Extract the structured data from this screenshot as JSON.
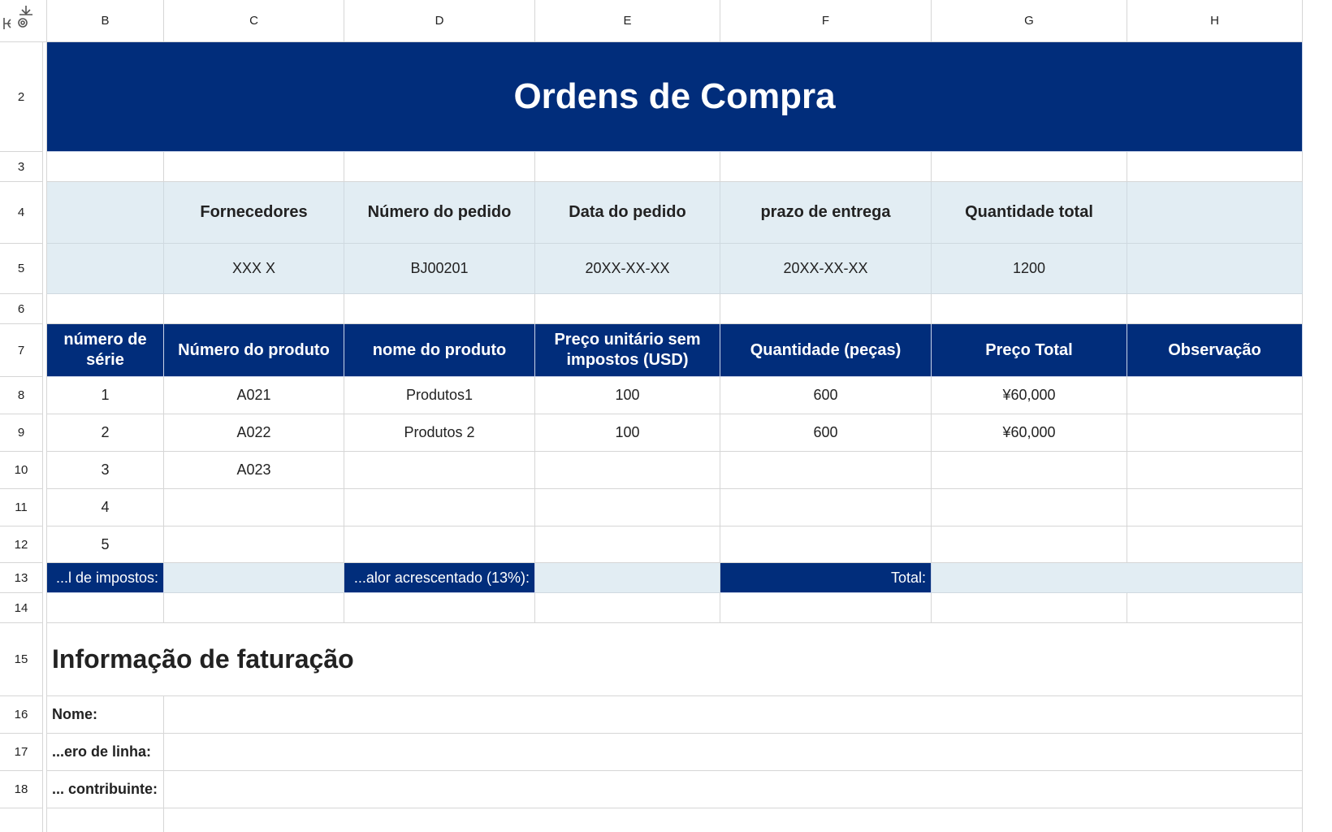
{
  "columns": [
    "B",
    "C",
    "D",
    "E",
    "F",
    "G",
    "H"
  ],
  "rows": [
    "2",
    "3",
    "4",
    "5",
    "6",
    "7",
    "8",
    "9",
    "10",
    "11",
    "12",
    "13",
    "14",
    "15",
    "16",
    "17",
    "18"
  ],
  "title": "Ordens de Compra",
  "summary": {
    "headers": [
      "Fornecedores",
      "Número do pedido",
      "Data do pedido",
      "prazo de entrega",
      "Quantidade total"
    ],
    "values": [
      "XXX X",
      "BJ00201",
      "20XX-XX-XX",
      "20XX-XX-XX",
      "1200"
    ]
  },
  "table": {
    "headers": [
      "número de série",
      "Número do produto",
      "nome do produto",
      "Preço unitário sem impostos (USD)",
      "Quantidade (peças)",
      "Preço Total",
      "Observação"
    ],
    "rows": [
      [
        "1",
        "A021",
        "Produtos1",
        "100",
        "600",
        "¥60,000",
        ""
      ],
      [
        "2",
        "A022",
        "Produtos 2",
        "100",
        "600",
        "¥60,000",
        ""
      ],
      [
        "3",
        "A023",
        "",
        "",
        "",
        "",
        ""
      ],
      [
        "4",
        "",
        "",
        "",
        "",
        "",
        ""
      ],
      [
        "5",
        "",
        "",
        "",
        "",
        "",
        ""
      ]
    ]
  },
  "totals": {
    "tax_label": "...l de impostos:",
    "vat_label": "...alor acrescentado (13%):",
    "total_label": "Total:"
  },
  "billing": {
    "title": "Informação de faturação",
    "name_label": "Nome:",
    "line_label": "...ero de linha:",
    "taxpayer_label": "... contribuinte:"
  },
  "colors": {
    "navy": "#012d7b",
    "light": "#e2edf3"
  }
}
